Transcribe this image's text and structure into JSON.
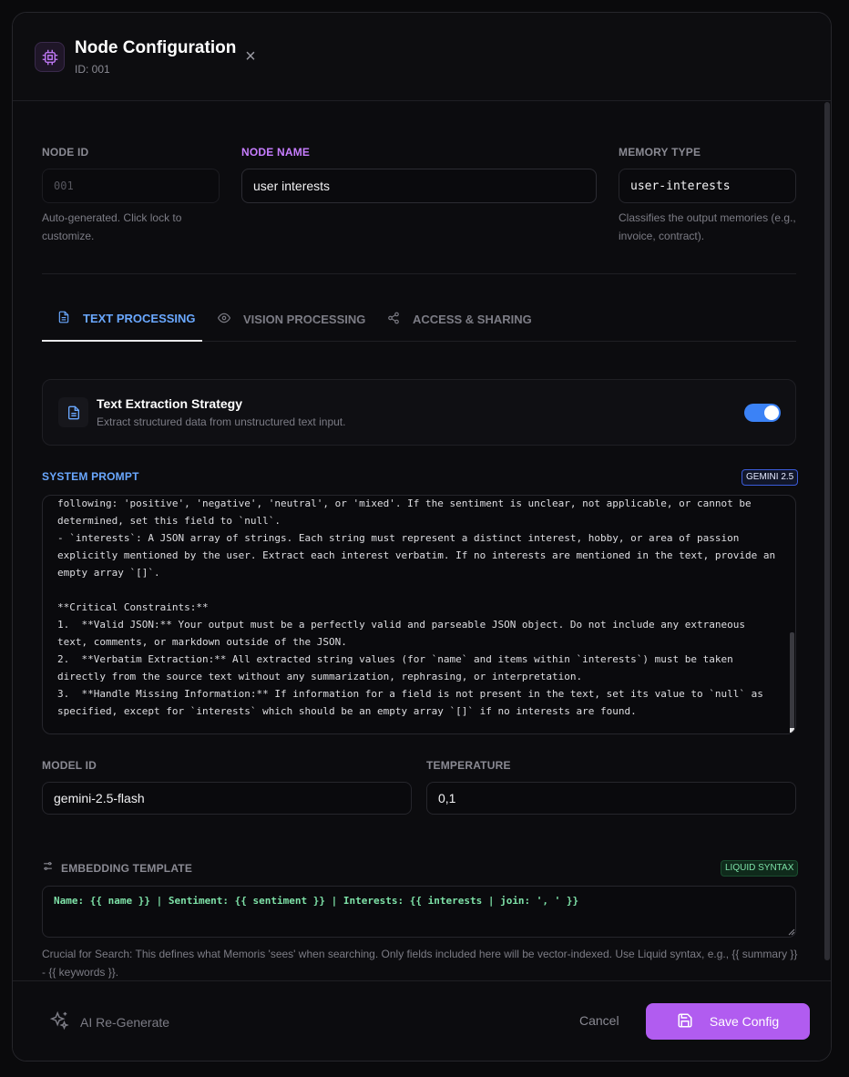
{
  "header": {
    "title": "Node Configuration",
    "subtitle": "ID: 001",
    "close_icon": "×"
  },
  "fields": {
    "node_id": {
      "label": "NODE ID",
      "placeholder": "001",
      "help": "Auto-generated. Click lock to customize."
    },
    "node_name": {
      "label": "NODE NAME",
      "value": "user interests"
    },
    "memory_type": {
      "label": "MEMORY TYPE",
      "value": "user-interests",
      "help": "Classifies the output memories (e.g., invoice, contract)."
    }
  },
  "tabs": [
    {
      "label": "TEXT PROCESSING",
      "icon": "document-icon",
      "active": true
    },
    {
      "label": "VISION PROCESSING",
      "icon": "eye-icon",
      "active": false
    },
    {
      "label": "ACCESS & SHARING",
      "icon": "share-icon",
      "active": false
    }
  ],
  "strategy": {
    "title": "Text Extraction Strategy",
    "description": "Extract structured data from unstructured text input.",
    "enabled": true
  },
  "system_prompt": {
    "label": "SYSTEM PROMPT",
    "badge": "GEMINI 2.5",
    "text": "following: 'positive', 'negative', 'neutral', or 'mixed'. If the sentiment is unclear, not applicable, or cannot be\ndetermined, set this field to `null`.\n- `interests`: A JSON array of strings. Each string must represent a distinct interest, hobby, or area of passion\nexplicitly mentioned by the user. Extract each interest verbatim. If no interests are mentioned in the text, provide an\nempty array `[]`.\n\n**Critical Constraints:**\n1.  **Valid JSON:** Your output must be a perfectly valid and parseable JSON object. Do not include any extraneous\ntext, comments, or markdown outside of the JSON.\n2.  **Verbatim Extraction:** All extracted string values (for `name` and items within `interests`) must be taken\ndirectly from the source text without any summarization, rephrasing, or interpretation.\n3.  **Handle Missing Information:** If information for a field is not present in the text, set its value to `null` as\nspecified, except for `interests` which should be an empty array `[]` if no interests are found."
  },
  "model": {
    "label": "MODEL ID",
    "value": "gemini-2.5-flash"
  },
  "temperature": {
    "label": "TEMPERATURE",
    "value": "0,1"
  },
  "embedding": {
    "label": "EMBEDDING TEMPLATE",
    "badge": "LIQUID SYNTAX",
    "value": "Name: {{ name }} | Sentiment: {{ sentiment }} | Interests: {{ interests | join: ', ' }}",
    "help": "Crucial for Search: This defines what Memoris 'sees' when searching. Only fields included here will be vector-indexed. Use Liquid syntax, e.g., {{ summary }} - {{ keywords }}."
  },
  "footer": {
    "regenerate_label": "AI Re-Generate",
    "cancel_label": "Cancel",
    "save_label": "Save Config"
  },
  "colors": {
    "accent_purple": "#b15cf0",
    "accent_blue": "#3b82f6",
    "liquid_green": "#7ee2a8"
  }
}
